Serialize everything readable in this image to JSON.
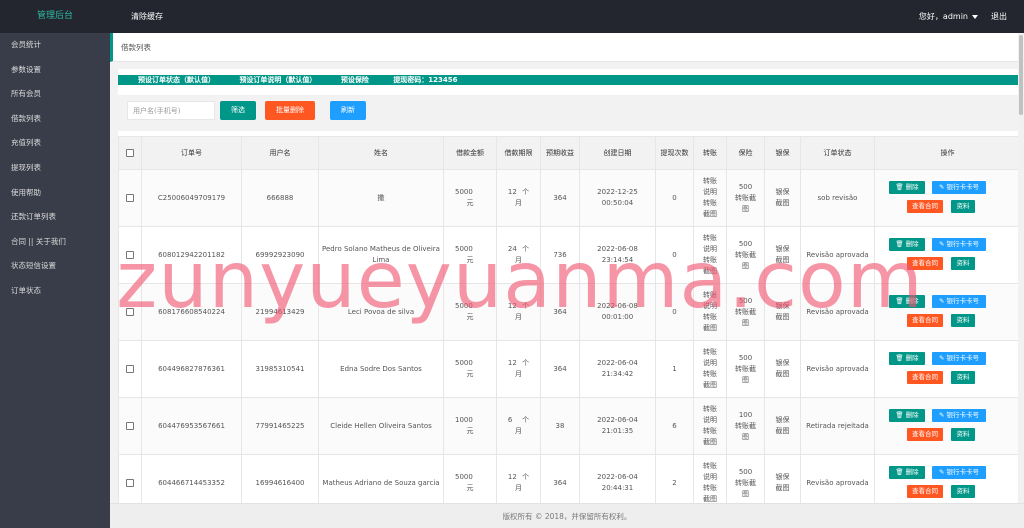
{
  "header": {
    "brand": "管理后台",
    "clear_cache": "清除缓存",
    "greeting": "您好，admin",
    "logout": "退出"
  },
  "sidebar": {
    "items": [
      {
        "label": "会员统计"
      },
      {
        "label": "参数设置"
      },
      {
        "label": "所有会员"
      },
      {
        "label": "借款列表"
      },
      {
        "label": "充值列表"
      },
      {
        "label": "提现列表"
      },
      {
        "label": "使用帮助"
      },
      {
        "label": "还款订单列表"
      },
      {
        "label": "合同 || 关于我们"
      },
      {
        "label": "状态短信设置"
      },
      {
        "label": "订单状态"
      }
    ]
  },
  "page": {
    "breadcrumb": "借款列表",
    "info": {
      "order_status_default": "预设订单状态（默认值）",
      "order_desc_default": "预设订单说明（默认值）",
      "insurance_default": "预设保险",
      "withdraw_code": "提现密码：123456"
    },
    "filter": {
      "placeholder": "用户名(手机号)",
      "filter_label": "筛选",
      "batch_delete_label": "批量删除",
      "refresh_label": "刷新"
    },
    "table": {
      "headers": {
        "order_no": "订单号",
        "username": "用户名",
        "name": "姓名",
        "amount": "借款金额",
        "period": "借款期限",
        "expected_income": "预期收益",
        "created": "创建日期",
        "withdraw_count": "提现次数",
        "transfer": "转账",
        "insurance": "保险",
        "bank_insurance": "银保",
        "status": "订单状态",
        "actions": "操作"
      },
      "rows": [
        {
          "order_no": "C25006049709179",
          "username": "666888",
          "name": "撒",
          "amount": "5000",
          "period": "12",
          "income": "364",
          "created_date": "2022-12-25",
          "created_time": "00:50:04",
          "withdraw_count": "0",
          "transfer": "转账说明转账截图",
          "insurance_amount": "500",
          "insurance_img": "转账截图",
          "bank": "银保截图",
          "status": "sob revisão"
        },
        {
          "order_no": "608012942201182",
          "username": "69992923090",
          "name": "Pedro Solano Matheus de Oliveira Lima",
          "amount": "5000",
          "period": "24",
          "income": "736",
          "created_date": "2022-06-08",
          "created_time": "23:14:54",
          "withdraw_count": "0",
          "transfer": "转账说明转账截图",
          "insurance_amount": "500",
          "insurance_img": "转账截图",
          "bank": "银保截图",
          "status": "Revisão aprovada"
        },
        {
          "order_no": "608176608540224",
          "username": "21994613429",
          "name": "Leci Povoa de silva",
          "amount": "5000",
          "period": "12",
          "income": "364",
          "created_date": "2022-06-08",
          "created_time": "00:01:00",
          "withdraw_count": "0",
          "transfer": "转账说明转账截图",
          "insurance_amount": "500",
          "insurance_img": "转账截图",
          "bank": "银保截图",
          "status": "Revisão aprovada"
        },
        {
          "order_no": "604496827876361",
          "username": "31985310541",
          "name": "Edna Sodre Dos Santos",
          "amount": "5000",
          "period": "12",
          "income": "364",
          "created_date": "2022-06-04",
          "created_time": "21:34:42",
          "withdraw_count": "1",
          "transfer": "转账说明转账截图",
          "insurance_amount": "500",
          "insurance_img": "转账截图",
          "bank": "银保截图",
          "status": "Revisão aprovada"
        },
        {
          "order_no": "604476953567661",
          "username": "77991465225",
          "name": "Cleide Hellen Oliveira Santos",
          "amount": "1000",
          "period": "6",
          "income": "38",
          "created_date": "2022-06-04",
          "created_time": "21:01:35",
          "withdraw_count": "6",
          "transfer": "转账说明转账截图",
          "insurance_amount": "100",
          "insurance_img": "转账截图",
          "bank": "银保截图",
          "status": "Retirada rejeitada"
        },
        {
          "order_no": "604466714453352",
          "username": "16994616400",
          "name": "Matheus Adriano de Souza garcia",
          "amount": "5000",
          "period": "12",
          "income": "364",
          "created_date": "2022-06-04",
          "created_time": "20:44:31",
          "withdraw_count": "2",
          "transfer": "转账说明转账截图",
          "insurance_amount": "500",
          "insurance_img": "转账截图",
          "bank": "银保截图",
          "status": "Revisão aprovada"
        }
      ],
      "units": {
        "currency": "元",
        "month_a": "个",
        "month_b": "月"
      },
      "actions": {
        "delete": "删除",
        "bank_card": "银行卡卡号",
        "view_contract": "查看合同",
        "data": "资料"
      }
    }
  },
  "footer": "版权所有 © 2018，并保留所有权利。",
  "watermark": "zunyueyuanma.com",
  "colors": {
    "accent": "#009688",
    "danger": "#ff5722",
    "info": "#1e9fff",
    "sidebar": "#393d49",
    "topbar": "#23262e"
  }
}
